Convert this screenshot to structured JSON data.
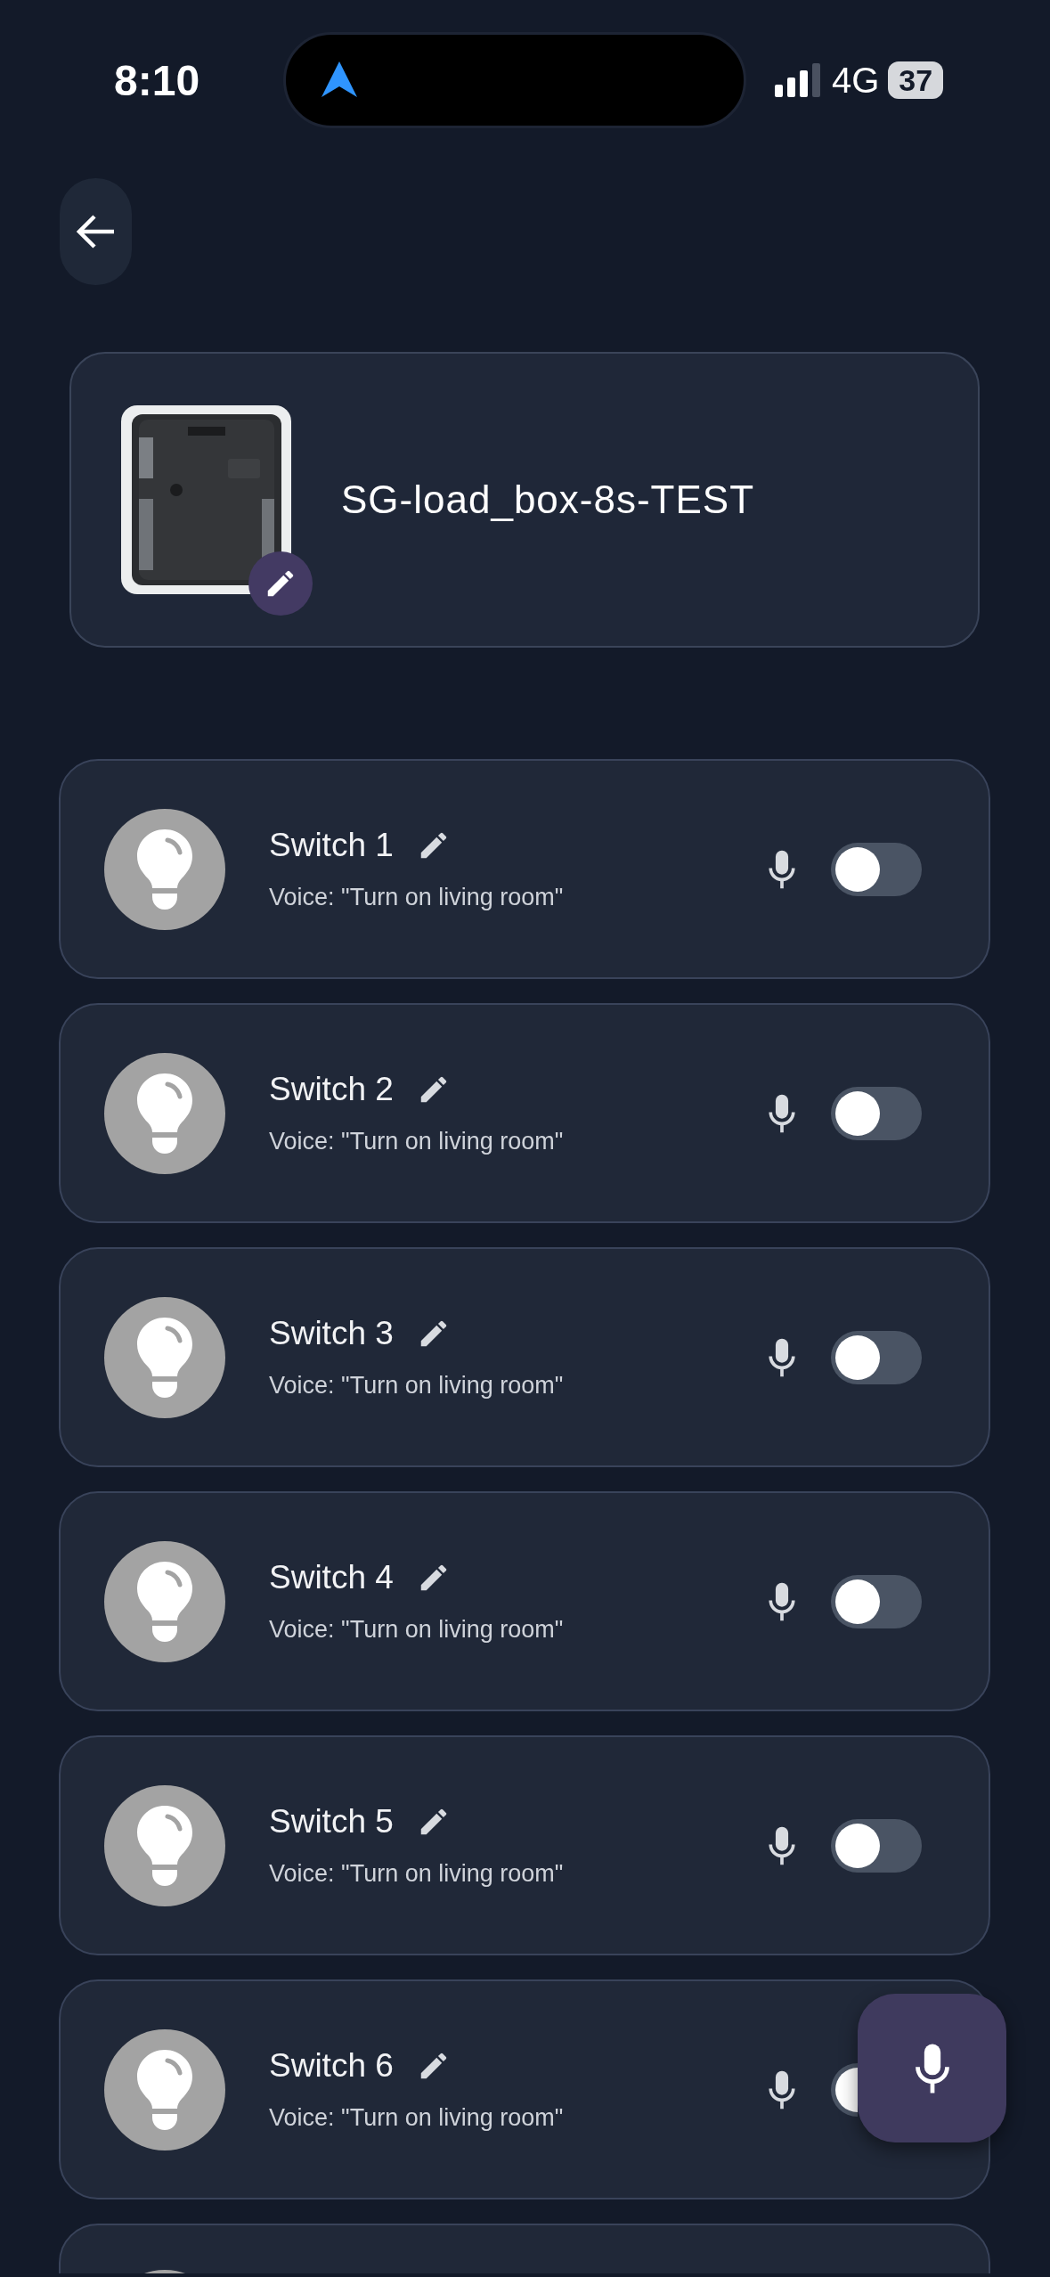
{
  "status_bar": {
    "time": "8:10",
    "network": "4G",
    "battery": "37"
  },
  "device": {
    "name": "SG-load_box-8s-TEST"
  },
  "switches": [
    {
      "kind": "switch",
      "name": "Switch 1",
      "voice": "Voice: \"Turn on living room\"",
      "on": false
    },
    {
      "kind": "switch",
      "name": "Switch 2",
      "voice": "Voice: \"Turn on living room\"",
      "on": false
    },
    {
      "kind": "switch",
      "name": "Switch 3",
      "voice": "Voice: \"Turn on living room\"",
      "on": false
    },
    {
      "kind": "switch",
      "name": "Switch 4",
      "voice": "Voice: \"Turn on living room\"",
      "on": false
    },
    {
      "kind": "switch",
      "name": "Switch 5",
      "voice": "Voice: \"Turn on living room\"",
      "on": false
    },
    {
      "kind": "switch",
      "name": "Switch 6",
      "voice": "Voice: \"Turn on living room\"",
      "on": false
    },
    {
      "kind": "partial"
    }
  ]
}
